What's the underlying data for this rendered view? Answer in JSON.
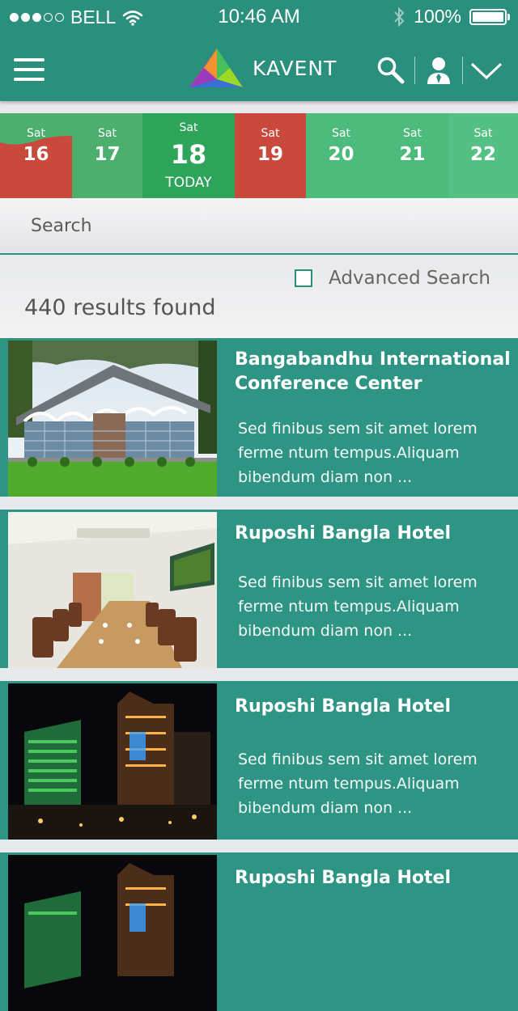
{
  "status_bar": {
    "carrier": "BELL",
    "time": "10:46 AM",
    "battery": "100%",
    "battery_level": 1.0,
    "signal_filled": 3,
    "signal_total": 5
  },
  "nav": {
    "brand": "KAVENT",
    "icons": [
      "menu-icon",
      "search-icon",
      "user-icon",
      "chevron-down-icon"
    ]
  },
  "dates": [
    {
      "dow": "Sat",
      "day": "16",
      "label": "",
      "color": "#c94a3c",
      "style": "split"
    },
    {
      "dow": "Sat",
      "day": "17",
      "label": "",
      "color": "#4caf6e"
    },
    {
      "dow": "Sat",
      "day": "18",
      "label": "TODAY",
      "color": "#2ea35a",
      "today": true
    },
    {
      "dow": "Sat",
      "day": "19",
      "label": "",
      "color": "#c94a3c"
    },
    {
      "dow": "Sat",
      "day": "20",
      "label": "",
      "color": "#4dbb7b"
    },
    {
      "dow": "Sat",
      "day": "21",
      "label": "",
      "color": "#4dbb7b"
    },
    {
      "dow": "Sat",
      "day": "22",
      "label": "",
      "color": "#55c083"
    }
  ],
  "search": {
    "placeholder": "Search",
    "advanced_label": "Advanced Search",
    "results_text": "440 results found"
  },
  "results": [
    {
      "title": "Bangabandhu International Conference Center",
      "desc": "Sed finibus sem sit amet lorem ferme ntum tempus.Aliquam bibendum diam non ...",
      "image": "conference-center"
    },
    {
      "title": "Ruposhi Bangla Hotel",
      "desc": "Sed finibus sem sit amet lorem ferme ntum tempus.Aliquam bibendum diam non ...",
      "image": "dining-room"
    },
    {
      "title": "Ruposhi Bangla Hotel",
      "desc": "Sed finibus sem sit amet lorem ferme ntum tempus.Aliquam bibendum diam non ...",
      "image": "hotel-night"
    },
    {
      "title": "Ruposhi Bangla Hotel",
      "desc": "",
      "image": "hotel-night"
    }
  ],
  "colors": {
    "primary": "#2a8f7c",
    "card": "#2e9483",
    "busy": "#c94a3c",
    "free": "#4caf6e"
  }
}
